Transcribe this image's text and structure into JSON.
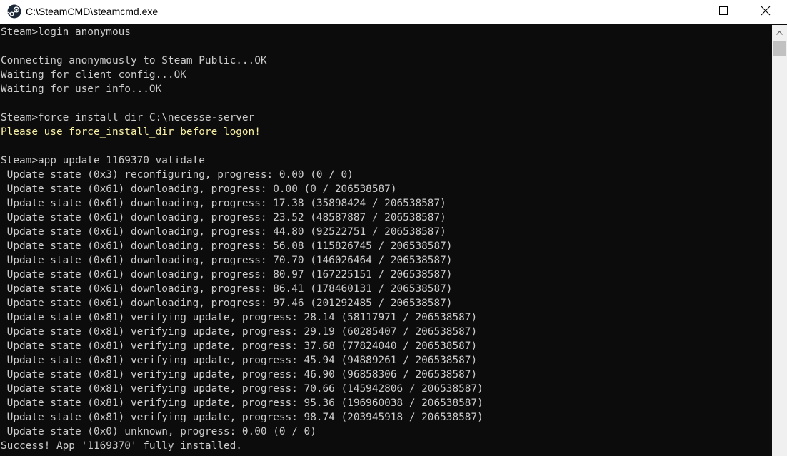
{
  "window": {
    "title": "C:\\SteamCMD\\steamcmd.exe",
    "icon": "steam-icon"
  },
  "caption_buttons": {
    "minimize_icon": "minimize-icon",
    "maximize_icon": "maximize-icon",
    "close_icon": "close-icon"
  },
  "colors": {
    "console_bg": "#0c0c0c",
    "console_text": "#cccccc",
    "warning_text": "#f9f1a5"
  },
  "console": {
    "lines": [
      {
        "text": "Steam>login anonymous",
        "style": "normal"
      },
      {
        "text": "",
        "style": "normal"
      },
      {
        "text": "Connecting anonymously to Steam Public...OK",
        "style": "normal"
      },
      {
        "text": "Waiting for client config...OK",
        "style": "normal"
      },
      {
        "text": "Waiting for user info...OK",
        "style": "normal"
      },
      {
        "text": "",
        "style": "normal"
      },
      {
        "text": "Steam>force_install_dir C:\\necesse-server",
        "style": "normal"
      },
      {
        "text": "Please use force_install_dir before logon!",
        "style": "yellow"
      },
      {
        "text": "",
        "style": "normal"
      },
      {
        "text": "Steam>app_update 1169370 validate",
        "style": "normal"
      },
      {
        "text": " Update state (0x3) reconfiguring, progress: 0.00 (0 / 0)",
        "style": "normal"
      },
      {
        "text": " Update state (0x61) downloading, progress: 0.00 (0 / 206538587)",
        "style": "normal"
      },
      {
        "text": " Update state (0x61) downloading, progress: 17.38 (35898424 / 206538587)",
        "style": "normal"
      },
      {
        "text": " Update state (0x61) downloading, progress: 23.52 (48587887 / 206538587)",
        "style": "normal"
      },
      {
        "text": " Update state (0x61) downloading, progress: 44.80 (92522751 / 206538587)",
        "style": "normal"
      },
      {
        "text": " Update state (0x61) downloading, progress: 56.08 (115826745 / 206538587)",
        "style": "normal"
      },
      {
        "text": " Update state (0x61) downloading, progress: 70.70 (146026464 / 206538587)",
        "style": "normal"
      },
      {
        "text": " Update state (0x61) downloading, progress: 80.97 (167225151 / 206538587)",
        "style": "normal"
      },
      {
        "text": " Update state (0x61) downloading, progress: 86.41 (178460131 / 206538587)",
        "style": "normal"
      },
      {
        "text": " Update state (0x61) downloading, progress: 97.46 (201292485 / 206538587)",
        "style": "normal"
      },
      {
        "text": " Update state (0x81) verifying update, progress: 28.14 (58117971 / 206538587)",
        "style": "normal"
      },
      {
        "text": " Update state (0x81) verifying update, progress: 29.19 (60285407 / 206538587)",
        "style": "normal"
      },
      {
        "text": " Update state (0x81) verifying update, progress: 37.68 (77824040 / 206538587)",
        "style": "normal"
      },
      {
        "text": " Update state (0x81) verifying update, progress: 45.94 (94889261 / 206538587)",
        "style": "normal"
      },
      {
        "text": " Update state (0x81) verifying update, progress: 46.90 (96858306 / 206538587)",
        "style": "normal"
      },
      {
        "text": " Update state (0x81) verifying update, progress: 70.66 (145942806 / 206538587)",
        "style": "normal"
      },
      {
        "text": " Update state (0x81) verifying update, progress: 95.36 (196960038 / 206538587)",
        "style": "normal"
      },
      {
        "text": " Update state (0x81) verifying update, progress: 98.74 (203945918 / 206538587)",
        "style": "normal"
      },
      {
        "text": " Update state (0x0) unknown, progress: 0.00 (0 / 0)",
        "style": "normal"
      },
      {
        "text": "Success! App '1169370' fully installed.",
        "style": "normal"
      }
    ]
  }
}
